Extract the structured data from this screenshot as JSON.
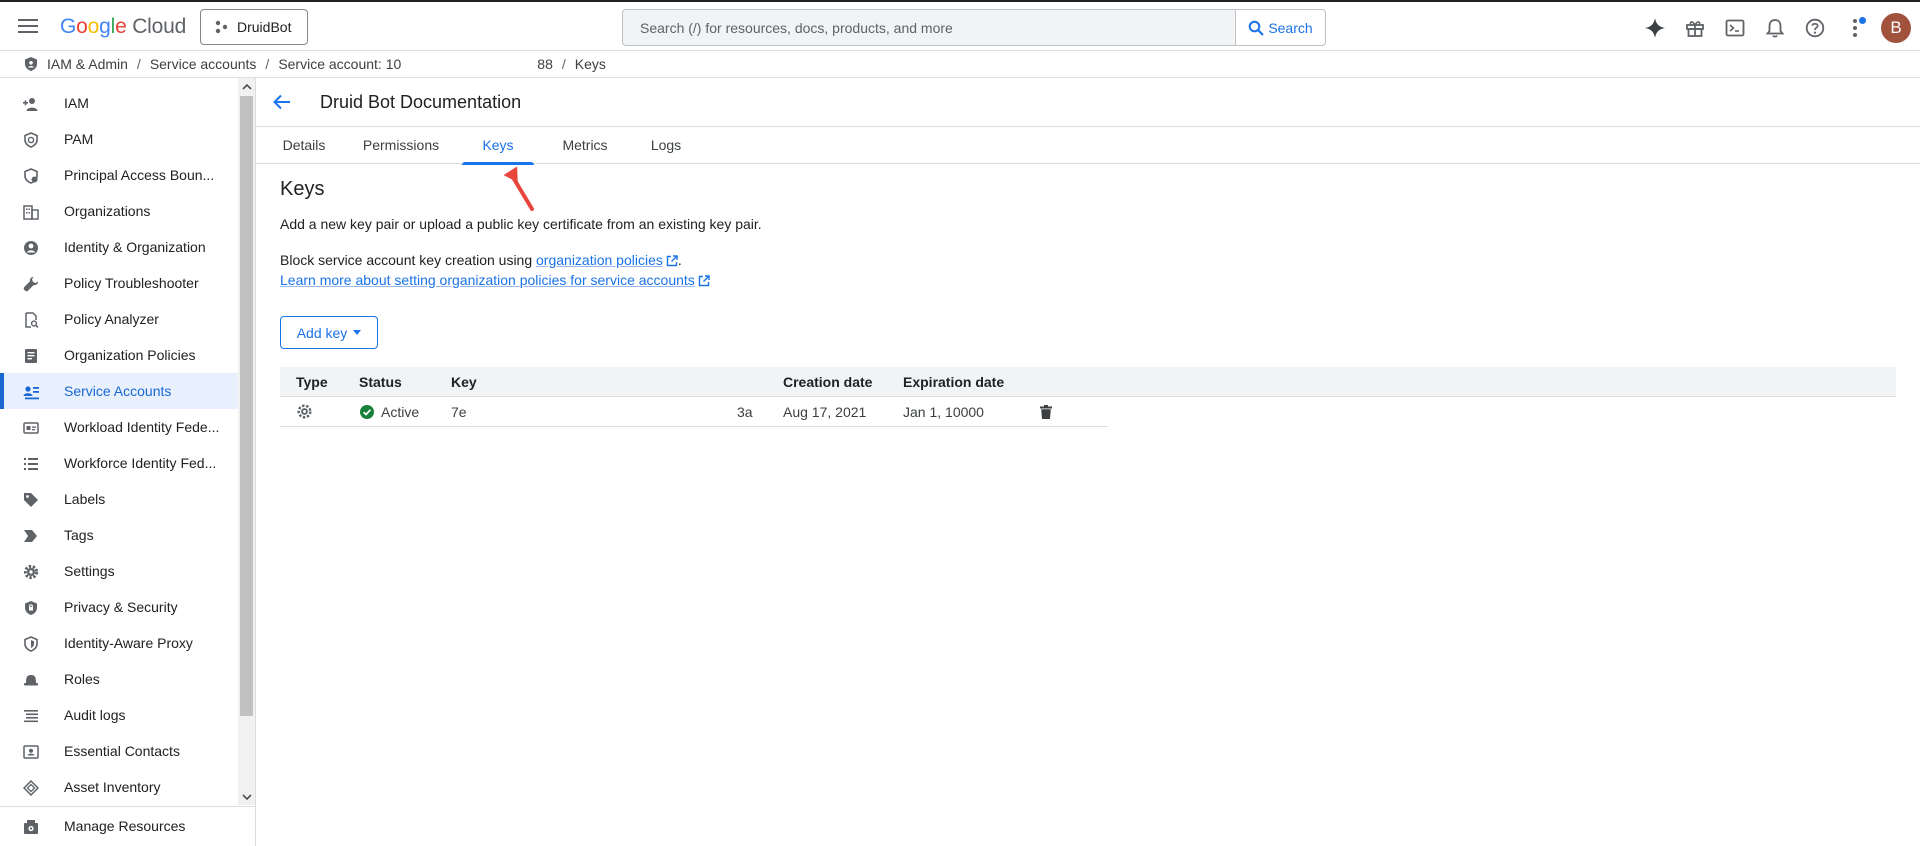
{
  "header": {
    "logo_google": "Google",
    "logo_cloud": "Cloud",
    "project_name": "DruidBot",
    "search_placeholder": "Search (/) for resources, docs, products, and more",
    "search_button": "Search",
    "avatar_initial": "B"
  },
  "breadcrumb": {
    "items": [
      "IAM & Admin",
      "Service accounts",
      "Service account: 10",
      "88",
      "Keys"
    ]
  },
  "sidebar": {
    "items": [
      {
        "label": "IAM",
        "icon": "add-person-icon"
      },
      {
        "label": "PAM",
        "icon": "shield-clock-icon"
      },
      {
        "label": "Principal Access Boun...",
        "icon": "shield-policy-icon"
      },
      {
        "label": "Organizations",
        "icon": "building-icon"
      },
      {
        "label": "Identity & Organization",
        "icon": "account-circle-icon"
      },
      {
        "label": "Policy Troubleshooter",
        "icon": "wrench-icon"
      },
      {
        "label": "Policy Analyzer",
        "icon": "document-search-icon"
      },
      {
        "label": "Organization Policies",
        "icon": "policy-document-icon"
      },
      {
        "label": "Service Accounts",
        "icon": "service-account-icon",
        "active": true
      },
      {
        "label": "Workload Identity Fede...",
        "icon": "id-card-icon"
      },
      {
        "label": "Workforce Identity Fed...",
        "icon": "list-icon"
      },
      {
        "label": "Labels",
        "icon": "tag-icon"
      },
      {
        "label": "Tags",
        "icon": "chevron-tag-icon"
      },
      {
        "label": "Settings",
        "icon": "gear-icon"
      },
      {
        "label": "Privacy & Security",
        "icon": "shield-lock-icon"
      },
      {
        "label": "Identity-Aware Proxy",
        "icon": "proxy-shield-icon"
      },
      {
        "label": "Roles",
        "icon": "hat-icon"
      },
      {
        "label": "Audit logs",
        "icon": "lines-icon"
      },
      {
        "label": "Essential Contacts",
        "icon": "contact-card-icon"
      },
      {
        "label": "Asset Inventory",
        "icon": "diamond-icon"
      }
    ],
    "footer_item": "Manage Resources"
  },
  "page": {
    "title": "Druid Bot Documentation",
    "tabs": [
      "Details",
      "Permissions",
      "Keys",
      "Metrics",
      "Logs"
    ],
    "active_tab": "Keys"
  },
  "keys_section": {
    "title": "Keys",
    "description": "Add a new key pair or upload a public key certificate from an existing key pair.",
    "policy_prefix": "Block service account key creation using ",
    "policy_link": "organization policies",
    "policy_suffix": ".",
    "learn_more_link": "Learn more about setting organization policies for service accounts",
    "add_key_button": "Add key"
  },
  "keys_table": {
    "columns": [
      "Type",
      "Status",
      "Key",
      "Creation date",
      "Expiration date"
    ],
    "rows": [
      {
        "type_icon": "gear-key-icon",
        "status": "Active",
        "key_start": "7е",
        "key_end": "3a",
        "creation_date": "Aug 17, 2021",
        "expiration_date": "Jan 1, 10000"
      }
    ]
  },
  "colors": {
    "accent": "#1a73e8",
    "active_nav_bg": "#e8f0fe",
    "status_active": "#188038",
    "annotation_arrow": "#e8453c"
  }
}
